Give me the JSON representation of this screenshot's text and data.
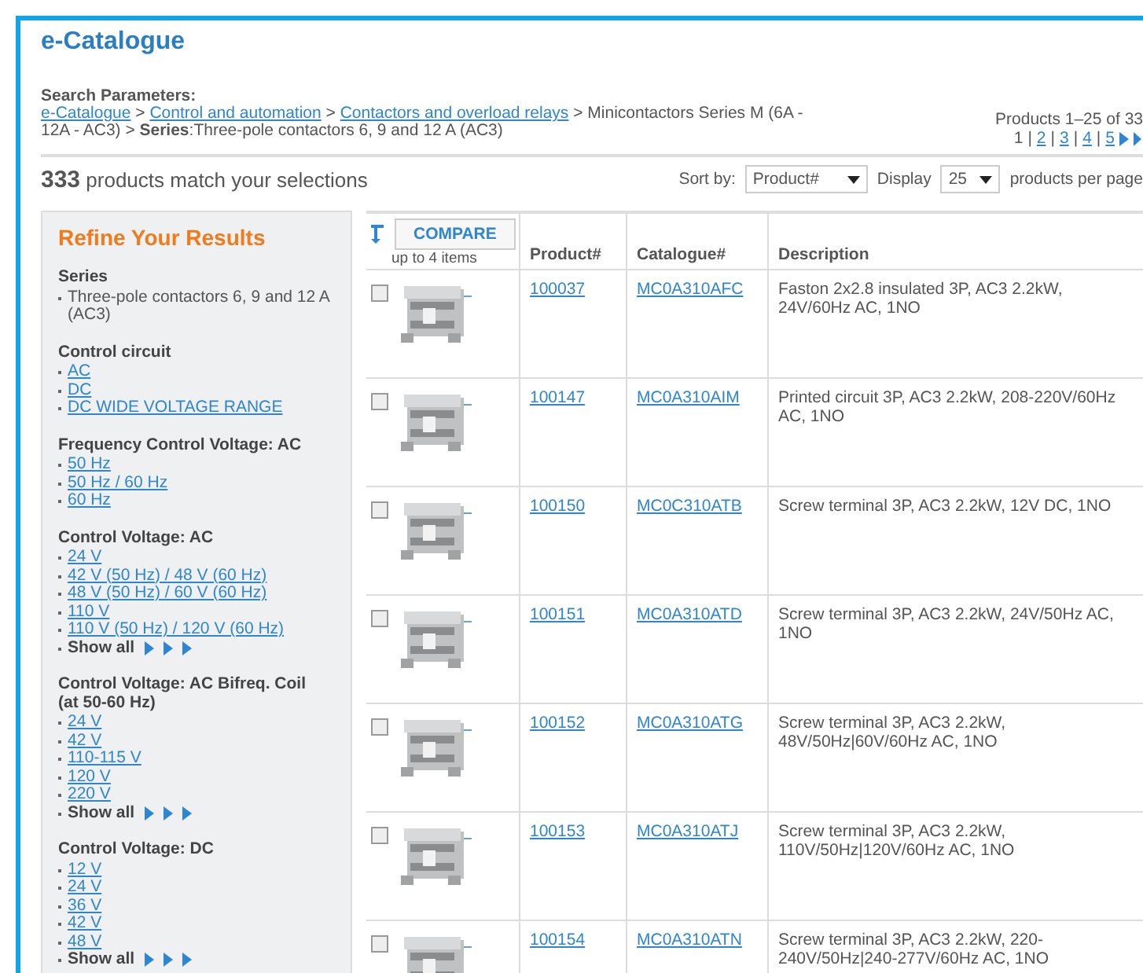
{
  "title": "e-Catalogue",
  "search_parameters": {
    "label": "Search Parameters:",
    "crumbs": [
      {
        "kind": "link",
        "text": "e-Catalogue"
      },
      {
        "kind": "sep",
        "text": ">"
      },
      {
        "kind": "link",
        "text": "Control and automation"
      },
      {
        "kind": "sep",
        "text": ">"
      },
      {
        "kind": "link",
        "text": "Contactors and overload relays"
      },
      {
        "kind": "sep",
        "text": "> Minicontactors Series M (6A - 12A - AC3) >"
      },
      {
        "kind": "bold",
        "text": "Series"
      },
      {
        "kind": "text",
        "text": ":Three-pole contactors 6, 9 and 12 A (AC3)"
      }
    ]
  },
  "pager": {
    "summary": "Products 1–25 of 33",
    "separator": "|",
    "pages": [
      {
        "label": "1",
        "selected": true
      },
      {
        "label": "2",
        "selected": false
      },
      {
        "label": "3",
        "selected": false
      },
      {
        "label": "4",
        "selected": false
      },
      {
        "label": "5",
        "selected": false
      }
    ]
  },
  "result_count": "333",
  "result_text": "products match your selections",
  "sort": {
    "label": "Sort by:",
    "value": "Product#"
  },
  "display": {
    "label": "Display",
    "value": "25",
    "suffix": "products per page"
  },
  "refine": {
    "title": "Refine Your Results",
    "groups": [
      {
        "title": "Series",
        "items": [
          {
            "kind": "text",
            "label": "Three-pole contactors 6, 9 and 12 A (AC3)"
          }
        ]
      },
      {
        "title": "Control circuit",
        "items": [
          {
            "kind": "link",
            "label": "AC"
          },
          {
            "kind": "link",
            "label": "DC"
          },
          {
            "kind": "link",
            "label": "DC WIDE VOLTAGE RANGE"
          }
        ]
      },
      {
        "title": "Frequency Control Voltage: AC",
        "items": [
          {
            "kind": "link",
            "label": "50 Hz"
          },
          {
            "kind": "link",
            "label": "50 Hz / 60 Hz"
          },
          {
            "kind": "link",
            "label": "60 Hz"
          }
        ]
      },
      {
        "title": "Control Voltage: AC",
        "items": [
          {
            "kind": "link",
            "label": "24 V"
          },
          {
            "kind": "link",
            "label": "42 V (50 Hz) / 48 V (60 Hz)"
          },
          {
            "kind": "link",
            "label": "48 V (50 Hz) / 60 V (60 Hz)"
          },
          {
            "kind": "link",
            "label": "110 V"
          },
          {
            "kind": "link",
            "label": "110 V (50 Hz) / 120 V (60 Hz)"
          },
          {
            "kind": "more",
            "label": "Show all"
          }
        ]
      },
      {
        "title": "Control Voltage: AC Bifreq. Coil (at 50-60 Hz)",
        "items": [
          {
            "kind": "link",
            "label": "24 V"
          },
          {
            "kind": "link",
            "label": "42 V"
          },
          {
            "kind": "link",
            "label": "110-115 V"
          },
          {
            "kind": "link",
            "label": "120 V"
          },
          {
            "kind": "link",
            "label": "220 V"
          },
          {
            "kind": "more",
            "label": "Show all"
          }
        ]
      },
      {
        "title": "Control Voltage: DC",
        "items": [
          {
            "kind": "link",
            "label": "12 V"
          },
          {
            "kind": "link",
            "label": "24 V"
          },
          {
            "kind": "link",
            "label": "36 V"
          },
          {
            "kind": "link",
            "label": "42 V"
          },
          {
            "kind": "link",
            "label": "48 V"
          },
          {
            "kind": "more",
            "label": "Show all"
          }
        ]
      }
    ]
  },
  "compare": {
    "button": "COMPARE",
    "note": "up to 4 items"
  },
  "table": {
    "columns": [
      "Product#",
      "Catalogue#",
      "Description"
    ],
    "rows": [
      {
        "checked": false,
        "product": "100037",
        "catalogue": "MC0A310AFC",
        "description": "Faston 2x2.8 insulated 3P, AC3 2.2kW, 24V/60Hz AC, 1NO"
      },
      {
        "checked": false,
        "product": "100147",
        "catalogue": "MC0A310AIM",
        "description": "Printed circuit 3P, AC3 2.2kW, 208-220V/60Hz AC, 1NO"
      },
      {
        "checked": false,
        "product": "100150",
        "catalogue": "MC0C310ATB",
        "description": "Screw terminal 3P, AC3 2.2kW, 12V DC, 1NO"
      },
      {
        "checked": false,
        "product": "100151",
        "catalogue": "MC0A310ATD",
        "description": "Screw terminal 3P, AC3 2.2kW, 24V/50Hz AC, 1NO"
      },
      {
        "checked": false,
        "product": "100152",
        "catalogue": "MC0A310ATG",
        "description": "Screw terminal 3P, AC3 2.2kW, 48V/50Hz|60V/60Hz AC, 1NO"
      },
      {
        "checked": false,
        "product": "100153",
        "catalogue": "MC0A310ATJ",
        "description": "Screw terminal 3P, AC3 2.2kW, 110V/50Hz|120V/60Hz AC, 1NO"
      },
      {
        "checked": false,
        "product": "100154",
        "catalogue": "MC0A310ATN",
        "description": "Screw terminal 3P, AC3 2.2kW, 220-240V/50Hz|240-277V/60Hz AC, 1NO"
      }
    ]
  }
}
